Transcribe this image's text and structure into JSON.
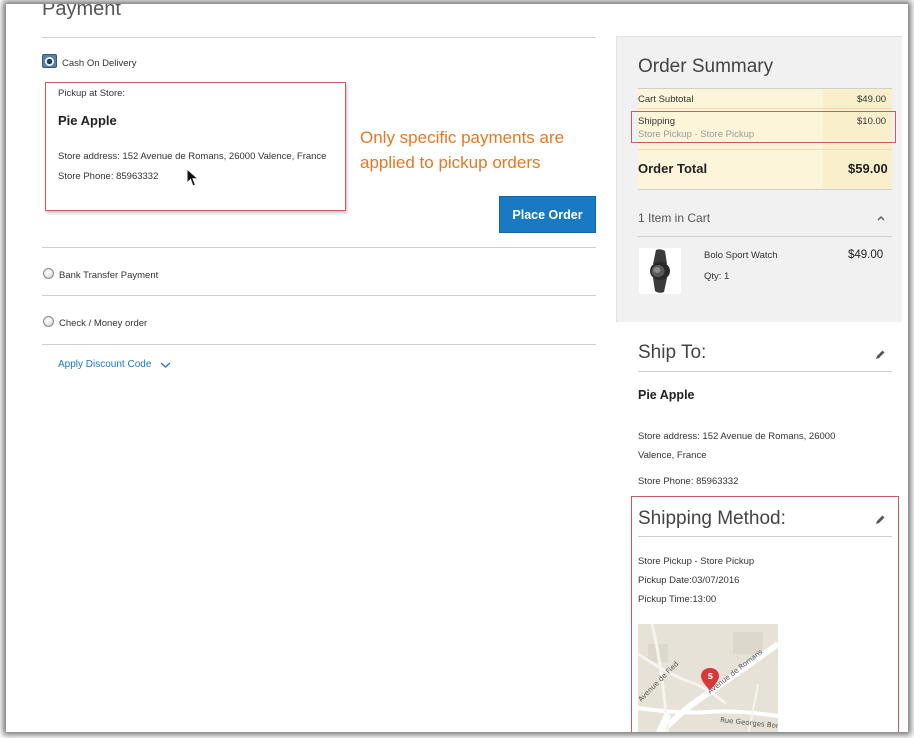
{
  "payment": {
    "title": "Payment",
    "methods": [
      {
        "label": "Cash On Delivery",
        "checked": true
      },
      {
        "label": "Bank Transfer Payment",
        "checked": false
      },
      {
        "label": "Check / Money order",
        "checked": false
      }
    ],
    "store": {
      "heading": "Pickup at Store:",
      "name": "Pie Apple",
      "address": "Store address: 152 Avenue de Romans, 26000 Valence, France",
      "phone": "Store Phone: 85963332"
    },
    "annotation_line1": "Only specific payments are",
    "annotation_line2": "applied to pickup orders",
    "place_order_label": "Place Order",
    "discount_label": "Apply Discount Code"
  },
  "summary": {
    "title": "Order Summary",
    "cart_subtotal_label": "Cart Subtotal",
    "cart_subtotal_value": "$49.00",
    "shipping_label": "Shipping",
    "shipping_value": "$10.00",
    "shipping_method": "Store Pickup - Store Pickup",
    "order_total_label": "Order Total",
    "order_total_value": "$59.00",
    "items_label": "1 Item in Cart",
    "product": {
      "name": "Bolo Sport Watch",
      "qty": "Qty: 1",
      "price": "$49.00"
    }
  },
  "ship_to": {
    "title": "Ship To:",
    "name": "Pie Apple",
    "address_line1": "Store address: 152 Avenue de Romans, 26000",
    "address_line2": "Valence, France",
    "phone": "Store Phone: 85963332"
  },
  "shipping_method": {
    "title": "Shipping Method:",
    "method": "Store Pickup - Store Pickup",
    "pickup_date": "Pickup Date:03/07/2016",
    "pickup_time": "Pickup Time:13:00",
    "map_labels": {
      "road1": "Avenue de Romans",
      "road2": "Avenue de Fied",
      "road3": "Rue Georges Bon",
      "marker": "S"
    }
  },
  "colors": {
    "accent_blue": "#1979c3",
    "highlight_red": "#c75b66",
    "annotation_orange": "#e87722",
    "totals_bg": "#fcf5d9"
  }
}
